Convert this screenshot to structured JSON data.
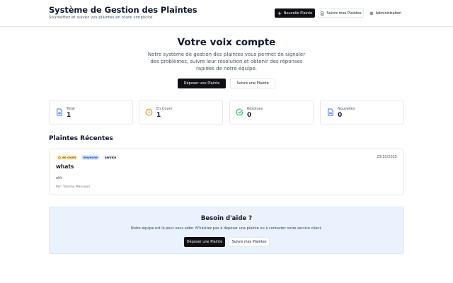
{
  "header": {
    "title": "Système de Gestion des Plaintes",
    "subtitle": "Soumettez et suivez vos plaintes en toute simplicité",
    "buttons": {
      "new_complaint": "Nouvelle Plainte",
      "track": "Suivre mes Plaintes",
      "admin": "Administration"
    }
  },
  "hero": {
    "title": "Votre voix compte",
    "text": "Notre système de gestion des plaintes vous permet de signaler des problèmes, suivre leur résolution et obtenir des réponses rapides de notre équipe.",
    "primary_button": "Déposer une Plainte",
    "secondary_button": "Suivre une Plainte"
  },
  "stats": [
    {
      "label": "Total",
      "value": "1",
      "icon": "document-icon",
      "color": "#2563eb"
    },
    {
      "label": "En Cours",
      "value": "1",
      "icon": "clock-icon",
      "color": "#d97706"
    },
    {
      "label": "Résolues",
      "value": "0",
      "icon": "check-circle-icon",
      "color": "#16a34a"
    },
    {
      "label": "Nouvelles",
      "value": "0",
      "icon": "document-icon",
      "color": "#2563eb"
    }
  ],
  "recent": {
    "section_title": "Plaintes Récentes",
    "items": [
      {
        "status": "en cours",
        "priority": "moyenne",
        "category": "service",
        "date": "25/10/2025",
        "title": "whats",
        "description": "ahh",
        "author": "Par: Yassine Mansouri"
      }
    ]
  },
  "help": {
    "title": "Besoin d'aide ?",
    "text": "Notre équipe est là pour vous aider. N'hésitez pas à déposer une plainte ou à contacter notre service client.",
    "primary_button": "Déposer une Plainte",
    "secondary_button": "Suivre mes Plaintes"
  }
}
